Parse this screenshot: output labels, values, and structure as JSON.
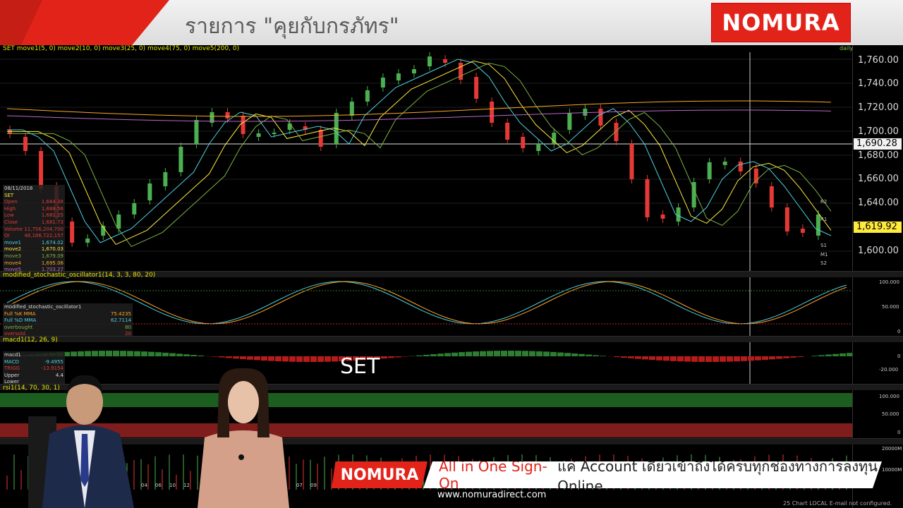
{
  "show": {
    "title": "รายการ \"คุยกับกรภัทร\"",
    "logo": "NOMURA"
  },
  "main_pane": {
    "title": "SET move1(5, 0) move2(10, 0) move3(25, 0) move4(75, 0) move5(200, 0)",
    "period": "daily",
    "price_labels": [
      "1,760.00",
      "1,740.00",
      "1,720.00",
      "1,700.00",
      "1,680.00",
      "1,660.00",
      "1,640.00",
      "1,620.00",
      "1,600.00"
    ],
    "cursor_price": "1,690.28",
    "last_price": "1,619.92",
    "pivot_labels": [
      "R2",
      "R1",
      "S1",
      "M1",
      "S2"
    ]
  },
  "data_window": {
    "date": "08/11/2018",
    "symbol": "SET",
    "rows": [
      {
        "label": "Open",
        "value": "1,684.38"
      },
      {
        "label": "High",
        "value": "1,688.56"
      },
      {
        "label": "Low",
        "value": "1,681.25"
      },
      {
        "label": "Close",
        "value": "1,681.73"
      },
      {
        "label": "Volume",
        "value": "11,756,204,700"
      },
      {
        "label": "OI",
        "value": "48,186,722,157"
      },
      {
        "label": "move1",
        "value": "1,674.02"
      },
      {
        "label": "move2",
        "value": "1,670.03"
      },
      {
        "label": "move3",
        "value": "1,679.09"
      },
      {
        "label": "move4",
        "value": "1,695.06"
      },
      {
        "label": "move5",
        "value": "1,703.27"
      }
    ]
  },
  "stoch_pane": {
    "title": "modified_stochastic_oscillator1(14, 3, 3, 80, 20)",
    "legend_title": "modified_stochastic_oscillator1",
    "rows": [
      {
        "label": "Full %K MMA",
        "value": "75.4235"
      },
      {
        "label": "Full %D MMA",
        "value": "62.7114"
      },
      {
        "label": "overbought",
        "value": "80"
      },
      {
        "label": "oversold",
        "value": "20"
      }
    ],
    "axis": [
      "100.000",
      "50.000",
      "0"
    ]
  },
  "macd_pane": {
    "title": "macd1(12, 26, 9)",
    "legend_title": "macd1",
    "rows": [
      {
        "label": "MACD",
        "value": "-9.4955"
      },
      {
        "label": "TRIGG",
        "value": "-13.9154"
      },
      {
        "label": "Upper",
        "value": "4.4"
      },
      {
        "label": "Lower",
        "value": ""
      }
    ],
    "axis": [
      "0",
      "-20.000"
    ],
    "overlay": "SET"
  },
  "rsi_pane": {
    "title": "rsi1(14, 70, 30, 1)",
    "axis": [
      "100.000",
      "50.000",
      "0"
    ]
  },
  "volume_pane": {
    "axis": [
      "20000M",
      "10000M"
    ],
    "dates": [
      "04",
      "06",
      "10",
      "12",
      "07",
      "09"
    ]
  },
  "ad": {
    "logo": "NOMURA",
    "highlight": "All in One Sign-On",
    "text": "แค่ Account เดียวเข้าถึงได้ครบทุกช่องทางการลงทุน Online",
    "url": "www.nomuradirect.com"
  },
  "status_bar": "25   Chart   LOCAL  E-mail not configured."
}
